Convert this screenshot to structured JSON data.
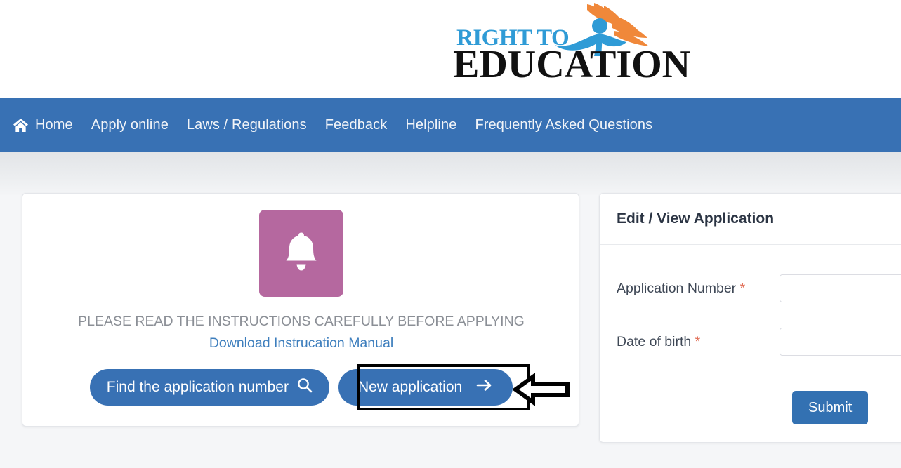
{
  "site": {
    "logo_line1": "RIGHT TO",
    "logo_line2": "EDUCATION",
    "logo_colors": {
      "line1": "#2f9bd6",
      "line2": "#111111",
      "accent_orange": "#f0883a",
      "accent_blue": "#2f9bd6"
    }
  },
  "nav": {
    "background": "#3871b4",
    "items": [
      {
        "label": "Home",
        "icon": "home-icon"
      },
      {
        "label": "Apply online",
        "icon": ""
      },
      {
        "label": "Laws / Regulations",
        "icon": ""
      },
      {
        "label": "Feedback",
        "icon": ""
      },
      {
        "label": "Helpline",
        "icon": ""
      },
      {
        "label": "Frequently Asked Questions",
        "icon": ""
      }
    ]
  },
  "notice_card": {
    "icon": "bell-icon",
    "icon_background": "#b5689f",
    "instructions_text": "PLEASE READ THE INSTRUCTIONS CAREFULLY BEFORE APPLYING ",
    "download_link": "Download Instrucation Manual",
    "buttons": {
      "find_application": {
        "label": "Find the application number",
        "icon": "search-icon"
      },
      "new_application": {
        "label": "New application",
        "icon": "arrow-right-icon",
        "highlighted": true
      }
    }
  },
  "edit_view_card": {
    "title": "Edit / View Application",
    "fields": [
      {
        "label": "Application Number",
        "required_mark": "*",
        "value": "",
        "placeholder": ""
      },
      {
        "label": "Date of birth",
        "required_mark": "*",
        "value": "",
        "placeholder": ""
      }
    ],
    "submit_label": "Submit"
  },
  "annotation": {
    "pointer_icon": "left-arrow-annotation",
    "highlight_target": "New application",
    "color": "#000000"
  }
}
